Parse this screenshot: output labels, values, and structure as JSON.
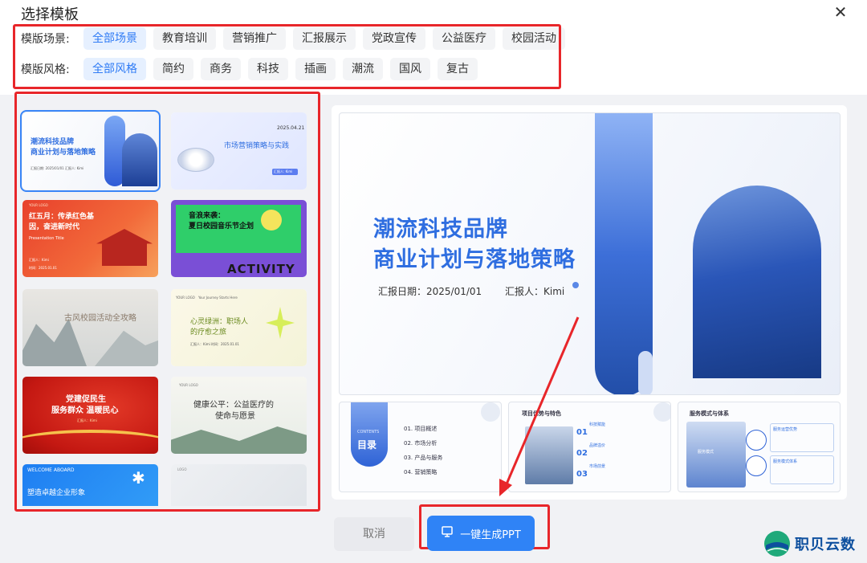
{
  "dialog": {
    "title": "选择模板",
    "close_icon": "close-icon"
  },
  "filters": {
    "scene": {
      "label": "模版场景:",
      "options": [
        "全部场景",
        "教育培训",
        "营销推广",
        "汇报展示",
        "党政宣传",
        "公益医疗",
        "校园活动"
      ],
      "selected": "全部场景"
    },
    "style": {
      "label": "模版风格:",
      "options": [
        "全部风格",
        "简约",
        "商务",
        "科技",
        "插画",
        "潮流",
        "国风",
        "复古"
      ],
      "selected": "全部风格"
    }
  },
  "templates": [
    {
      "lines": [
        "潮流科技品牌",
        "商业计划与落地策略"
      ],
      "sub": "汇报日期: 2025/01/01      汇报人: Kimi",
      "selected": true
    },
    {
      "date": "2025.04.21",
      "lines": [
        "市场营销策略与实践"
      ],
      "sub": "汇报人: Kimi"
    },
    {
      "header": "YOUR LOGO",
      "lines": [
        "红五月：传承红色基",
        "因，奋进新时代"
      ],
      "en": "Presentation Title",
      "sub1": "汇报人：Kimi",
      "sub2": "时间：2025.01.01"
    },
    {
      "lines": [
        "音浪来袭：",
        "夏日校园音乐节企划"
      ],
      "banner": "ACTIVITY"
    },
    {
      "lines": [
        "古风校园活动全攻略"
      ]
    },
    {
      "header": "YOUR LOGO",
      "tagline": "Your Journey Starts Here",
      "lines": [
        "心灵绿洲：职场人",
        "的疗愈之旅"
      ],
      "sub": "汇报人：Kimi      时间：2025.01.01"
    },
    {
      "lines": [
        "党建促民生",
        "服务群众 温暖民心"
      ],
      "sub": "汇报人：Kimi"
    },
    {
      "header": "YOUR LOGO",
      "lines": [
        "健康公平：公益医疗的",
        "使命与愿景"
      ]
    },
    {
      "header": "WELCOME ABOARD",
      "lines": [
        "塑造卓越企业形象"
      ]
    },
    {
      "header": "LOGO"
    }
  ],
  "preview": {
    "title_line1": "潮流科技品牌",
    "title_line2": "商业计划与落地策略",
    "date_label": "汇报日期：2025/01/01",
    "reporter_label": "汇报人：Kimi",
    "pages": {
      "contents": {
        "en": "CONTENTS",
        "zh": "目录",
        "items": [
          "01. 项目概述",
          "02. 市场分析",
          "03. 产品与服务",
          "04. 营销策略"
        ]
      },
      "features": {
        "title": "项目优势与特色",
        "nums": [
          "01",
          "02",
          "03"
        ],
        "heads": [
          "科技赋能",
          "品牌溢价",
          "市场前景"
        ]
      },
      "service": {
        "title": "服务模式与体系",
        "heads": [
          "服务运营优势",
          "服务模式体系"
        ],
        "center": "服务模式"
      }
    }
  },
  "actions": {
    "cancel_label": "取消",
    "generate_label": "一键生成PPT"
  },
  "watermark": {
    "text": "职贝云数"
  },
  "colors": {
    "accent": "#2f83f6",
    "highlight": "#e8262a",
    "chip_active_bg": "#e6f0ff"
  }
}
